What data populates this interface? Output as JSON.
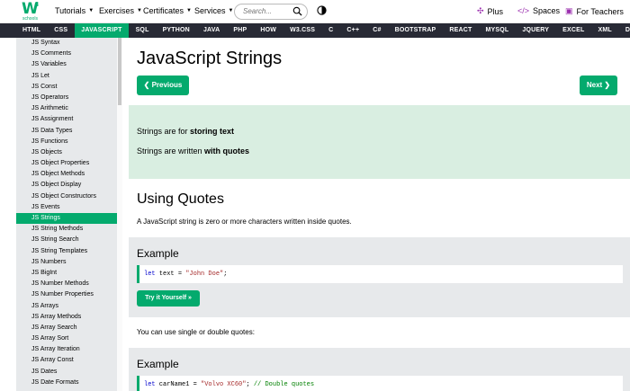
{
  "header": {
    "logo_text": "W",
    "logo_super": "3",
    "logo_sub": "schools",
    "nav": [
      {
        "label": "Tutorials"
      },
      {
        "label": "Exercises"
      },
      {
        "label": "Certificates"
      },
      {
        "label": "Services"
      }
    ],
    "search_placeholder": "Search...",
    "right": [
      {
        "icon": "plus-icon",
        "label": "Plus"
      },
      {
        "icon": "code-icon",
        "label": "Spaces"
      },
      {
        "icon": "teacher-icon",
        "label": "For Teachers"
      }
    ]
  },
  "langbar": [
    "HTML",
    "CSS",
    "JAVASCRIPT",
    "SQL",
    "PYTHON",
    "JAVA",
    "PHP",
    "HOW TO",
    "W3.CSS",
    "C",
    "C++",
    "C#",
    "BOOTSTRAP",
    "REACT",
    "MYSQL",
    "JQUERY",
    "EXCEL",
    "XML",
    "DJANGO"
  ],
  "langbar_active": "JAVASCRIPT",
  "sidebar": {
    "items": [
      "JS Syntax",
      "JS Comments",
      "JS Variables",
      "JS Let",
      "JS Const",
      "JS Operators",
      "JS Arithmetic",
      "JS Assignment",
      "JS Data Types",
      "JS Functions",
      "JS Objects",
      "JS Object Properties",
      "JS Object Methods",
      "JS Object Display",
      "JS Object Constructors",
      "JS Events",
      "JS Strings",
      "JS String Methods",
      "JS String Search",
      "JS String Templates",
      "JS Numbers",
      "JS BigInt",
      "JS Number Methods",
      "JS Number Properties",
      "JS Arrays",
      "JS Array Methods",
      "JS Array Search",
      "JS Array Sort",
      "JS Array Iteration",
      "JS Array Const",
      "JS Dates",
      "JS Date Formats"
    ],
    "active": "JS Strings"
  },
  "main": {
    "title": "JavaScript Strings",
    "prev_label": "❮ Previous",
    "next_label": "Next ❯",
    "intro": {
      "line1_pre": "Strings are for ",
      "line1_bold": "storing text",
      "line2_pre": "Strings are written ",
      "line2_bold": "with quotes"
    },
    "section_title": "Using Quotes",
    "section_desc": "A JavaScript string is zero or more characters written inside quotes.",
    "example1": {
      "heading": "Example",
      "code_kw": "let",
      "code_rest": " text = ",
      "code_str": "\"John Doe\"",
      "code_end": ";",
      "try_label": "Try it Yourself »"
    },
    "note": "You can use single or double quotes:",
    "example2": {
      "heading": "Example",
      "code_kw": "let",
      "code_rest": " carName1 = ",
      "code_str": "\"Volvo XC60\"",
      "code_end": ";  ",
      "code_comment": "// Double quotes"
    }
  },
  "colors": {
    "accent": "#04AA6D",
    "navbar": "#282A35",
    "sidebar": "#E7E9EB",
    "intro_bg": "#D9EEE1"
  }
}
